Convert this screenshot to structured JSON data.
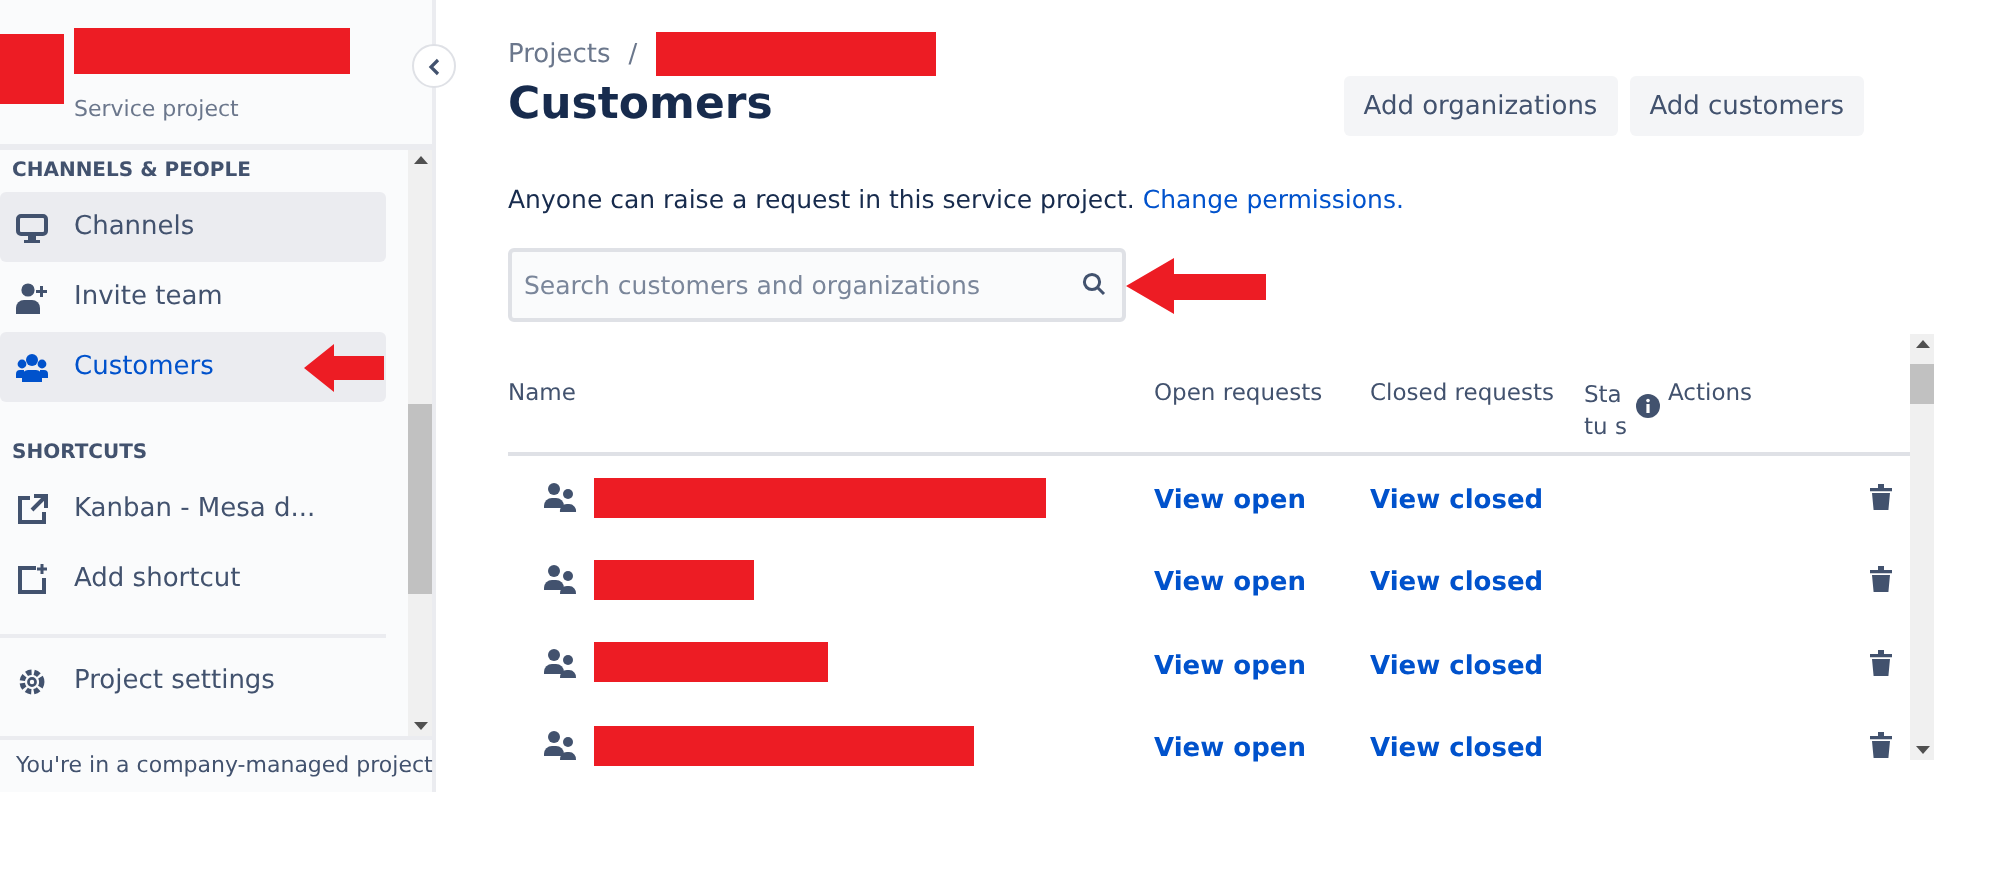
{
  "sidebar": {
    "project_logo": {
      "redacted": true
    },
    "project_name": {
      "redacted": true
    },
    "project_type": "Service project",
    "sections": [
      {
        "heading": "CHANNELS & PEOPLE",
        "items": [
          {
            "label": "Channels",
            "selected": false,
            "hovered": true,
            "annotation_arrow": false
          },
          {
            "label": "Invite team",
            "selected": false,
            "hovered": false,
            "annotation_arrow": false
          },
          {
            "label": "Customers",
            "selected": true,
            "hovered": false,
            "annotation_arrow": true
          }
        ]
      },
      {
        "heading": "SHORTCUTS",
        "items": [
          {
            "label": "Kanban - Mesa d...",
            "selected": false,
            "hovered": false,
            "annotation_arrow": false
          },
          {
            "label": "Add shortcut",
            "selected": false,
            "hovered": false,
            "annotation_arrow": false
          }
        ]
      }
    ],
    "settings_item": "Project settings",
    "footer": "You're in a company-managed project"
  },
  "breadcrumb": {
    "root": "Projects",
    "separator": "/",
    "current_redacted": true
  },
  "title": "Customers",
  "actions": [
    "Add organizations",
    "Add customers"
  ],
  "description": {
    "text": "Anyone can raise a request in this service project.",
    "link": "Change permissions."
  },
  "search": {
    "placeholder": "Search customers and organizations",
    "annotation_arrow": true
  },
  "table": {
    "columns": [
      "Name",
      "Open requests",
      "Closed requests",
      "Statu s",
      "Actions"
    ],
    "rows": [
      {
        "name_redacted": true,
        "open": "View open",
        "closed": "View closed"
      },
      {
        "name_redacted": true,
        "open": "View open",
        "closed": "View closed"
      },
      {
        "name_redacted": true,
        "open": "View open",
        "closed": "View closed"
      },
      {
        "name_redacted": true,
        "open": "View open",
        "closed": "View closed"
      }
    ]
  }
}
